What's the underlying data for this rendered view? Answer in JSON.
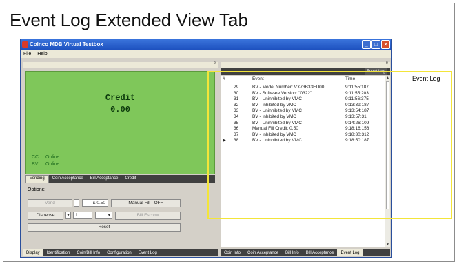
{
  "slide": {
    "title": "Event Log Extended View Tab"
  },
  "window": {
    "title": "Coinco MDB Virtual Testbox",
    "menu": [
      "File",
      "Help"
    ]
  },
  "credit": {
    "label": "Credit",
    "value": "0.00"
  },
  "status": [
    {
      "code": "CC",
      "state": "Online"
    },
    {
      "code": "BV",
      "state": "Online"
    }
  ],
  "left_tabs": [
    "Vending",
    "Coin Acceptance",
    "Bill Acceptance",
    "Credit"
  ],
  "options": {
    "label": "Options:",
    "vend": "Vend",
    "price": "£ 0.50",
    "manual_fill": "Manual Fill - OFF",
    "dispense": "Dispense",
    "dispense_qty": "1",
    "bill_escrow": "Bill Escrow",
    "reset": "Reset"
  },
  "bottom_tabs": [
    "Display",
    "Identification",
    "Coin/Bill Info",
    "Configuration",
    "Event Log"
  ],
  "event_log": {
    "title": "Event Log",
    "columns": {
      "num": "#",
      "event": "Event",
      "time": "Time"
    },
    "rows": [
      {
        "num": "29",
        "event": "BV - Model Number: VX73B33EU00",
        "time": "9:11:55:187"
      },
      {
        "num": "30",
        "event": "BV - Software Version: \"0322\"",
        "time": "9:11:55:203"
      },
      {
        "num": "31",
        "event": "BV - Uninhibited by VMC",
        "time": "9:11:56:375"
      },
      {
        "num": "32",
        "event": "BV - Inhibited by VMC",
        "time": "9:13:39:187"
      },
      {
        "num": "33",
        "event": "BV - Uninhibited by VMC",
        "time": "9:13:54:187"
      },
      {
        "num": "34",
        "event": "BV - Inhibited by VMC",
        "time": "9:13:57:31"
      },
      {
        "num": "35",
        "event": "BV - Uninhibited by VMC",
        "time": "9:14:26:109"
      },
      {
        "num": "36",
        "event": "Manual Fill Credit: 0.50",
        "time": "9:18:16:156"
      },
      {
        "num": "37",
        "event": "BV - Inhibited by VMC",
        "time": "9:18:30:312"
      },
      {
        "num": "38",
        "event": "BV - Uninhibited by VMC",
        "time": "9:18:50:187"
      }
    ]
  },
  "right_tabs": [
    "Coin Info",
    "Coin Acceptance",
    "Bill Info",
    "Bill Acceptance",
    "Event Log"
  ],
  "callout": {
    "label": "Event Log"
  },
  "colors": {
    "credit_bg": "#7fc75a",
    "callout": "#f3e53a",
    "titlebar": "#2a5fc9"
  }
}
